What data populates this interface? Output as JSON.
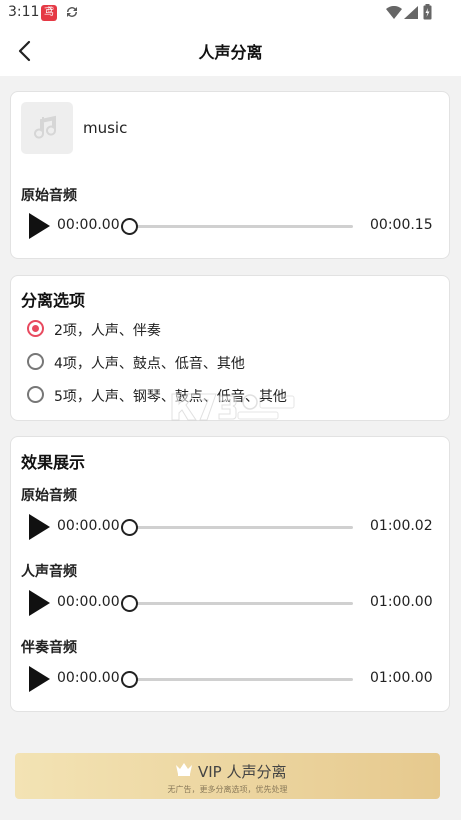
{
  "status_bar": {
    "time": "3:11",
    "app_badge": "鸢"
  },
  "header": {
    "title": "人声分离"
  },
  "file": {
    "name": "music"
  },
  "original": {
    "label": "原始音频",
    "current": "00:00.00",
    "total": "00:00.15",
    "progress": 0
  },
  "separation": {
    "title": "分离选项",
    "options": [
      {
        "label": "2项，人声、伴奏",
        "selected": true
      },
      {
        "label": "4项，人声、鼓点、低音、其他",
        "selected": false
      },
      {
        "label": "5项，人声、钢琴、鼓点、低音、其他",
        "selected": false
      }
    ]
  },
  "effects": {
    "title": "效果展示",
    "tracks": [
      {
        "label": "原始音频",
        "current": "00:00.00",
        "total": "01:00.02",
        "progress": 0
      },
      {
        "label": "人声音频",
        "current": "00:00.00",
        "total": "01:00.00",
        "progress": 0
      },
      {
        "label": "伴奏音频",
        "current": "00:00.00",
        "total": "01:00.00",
        "progress": 0
      }
    ]
  },
  "vip": {
    "label": "VIP 人声分离",
    "subtitle": "无广告，更多分离选项，优先处理"
  },
  "colors": {
    "accent": "#e84a5f",
    "vip_start": "#f3e3b4",
    "vip_end": "#e6c98e"
  }
}
